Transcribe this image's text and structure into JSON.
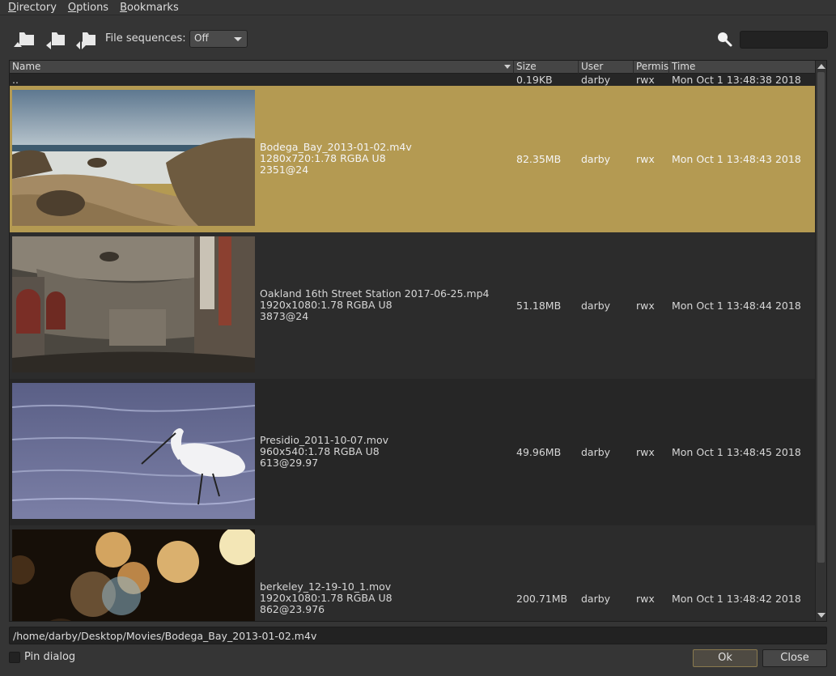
{
  "menu": {
    "directory": "Directory",
    "options": "Options",
    "bookmarks": "Bookmarks"
  },
  "toolbar": {
    "icons": [
      "folder-up-icon",
      "folder-back-icon",
      "folder-forward-icon"
    ],
    "file_sequences_label": "File sequences:",
    "file_sequences_value": "Off",
    "search_placeholder": ""
  },
  "table": {
    "columns": [
      "Name",
      "Size",
      "User",
      "Permis",
      "Time"
    ],
    "parent_row": {
      "name": "..",
      "size": "0.19KB",
      "user": "darby",
      "perms": "rwx",
      "time": "Mon Oct  1 13:48:38 2018"
    },
    "rows": [
      {
        "name": "Bodega_Bay_2013-01-02.m4v",
        "format": "1280x720:1.78 RGBA U8",
        "frames": "2351@24",
        "size": "82.35MB",
        "user": "darby",
        "perms": "rwx",
        "time": "Mon Oct  1 13:48:43 2018",
        "thumb": "beach-thumbnail"
      },
      {
        "name": "Oakland 16th Street Station 2017-06-25.mp4",
        "format": "1920x1080:1.78 RGBA U8",
        "frames": "3873@24",
        "size": "51.18MB",
        "user": "darby",
        "perms": "rwx",
        "time": "Mon Oct  1 13:48:44 2018",
        "thumb": "station-thumbnail"
      },
      {
        "name": "Presidio_2011-10-07.mov",
        "format": "960x540:1.78 RGBA U8",
        "frames": "613@29.97",
        "size": "49.96MB",
        "user": "darby",
        "perms": "rwx",
        "time": "Mon Oct  1 13:48:45 2018",
        "thumb": "egret-thumbnail"
      },
      {
        "name": "berkeley_12-19-10_1.mov",
        "format": "1920x1080:1.78 RGBA U8",
        "frames": "862@23.976",
        "size": "200.71MB",
        "user": "darby",
        "perms": "rwx",
        "time": "Mon Oct  1 13:48:42 2018",
        "thumb": "bokeh-thumbnail"
      }
    ]
  },
  "path": "/home/darby/Desktop/Movies/Bodega_Bay_2013-01-02.m4v",
  "footer": {
    "pin_label": "Pin dialog",
    "ok_label": "Ok",
    "close_label": "Close"
  },
  "colors": {
    "selection": "#b49a52",
    "background": "#353535"
  }
}
